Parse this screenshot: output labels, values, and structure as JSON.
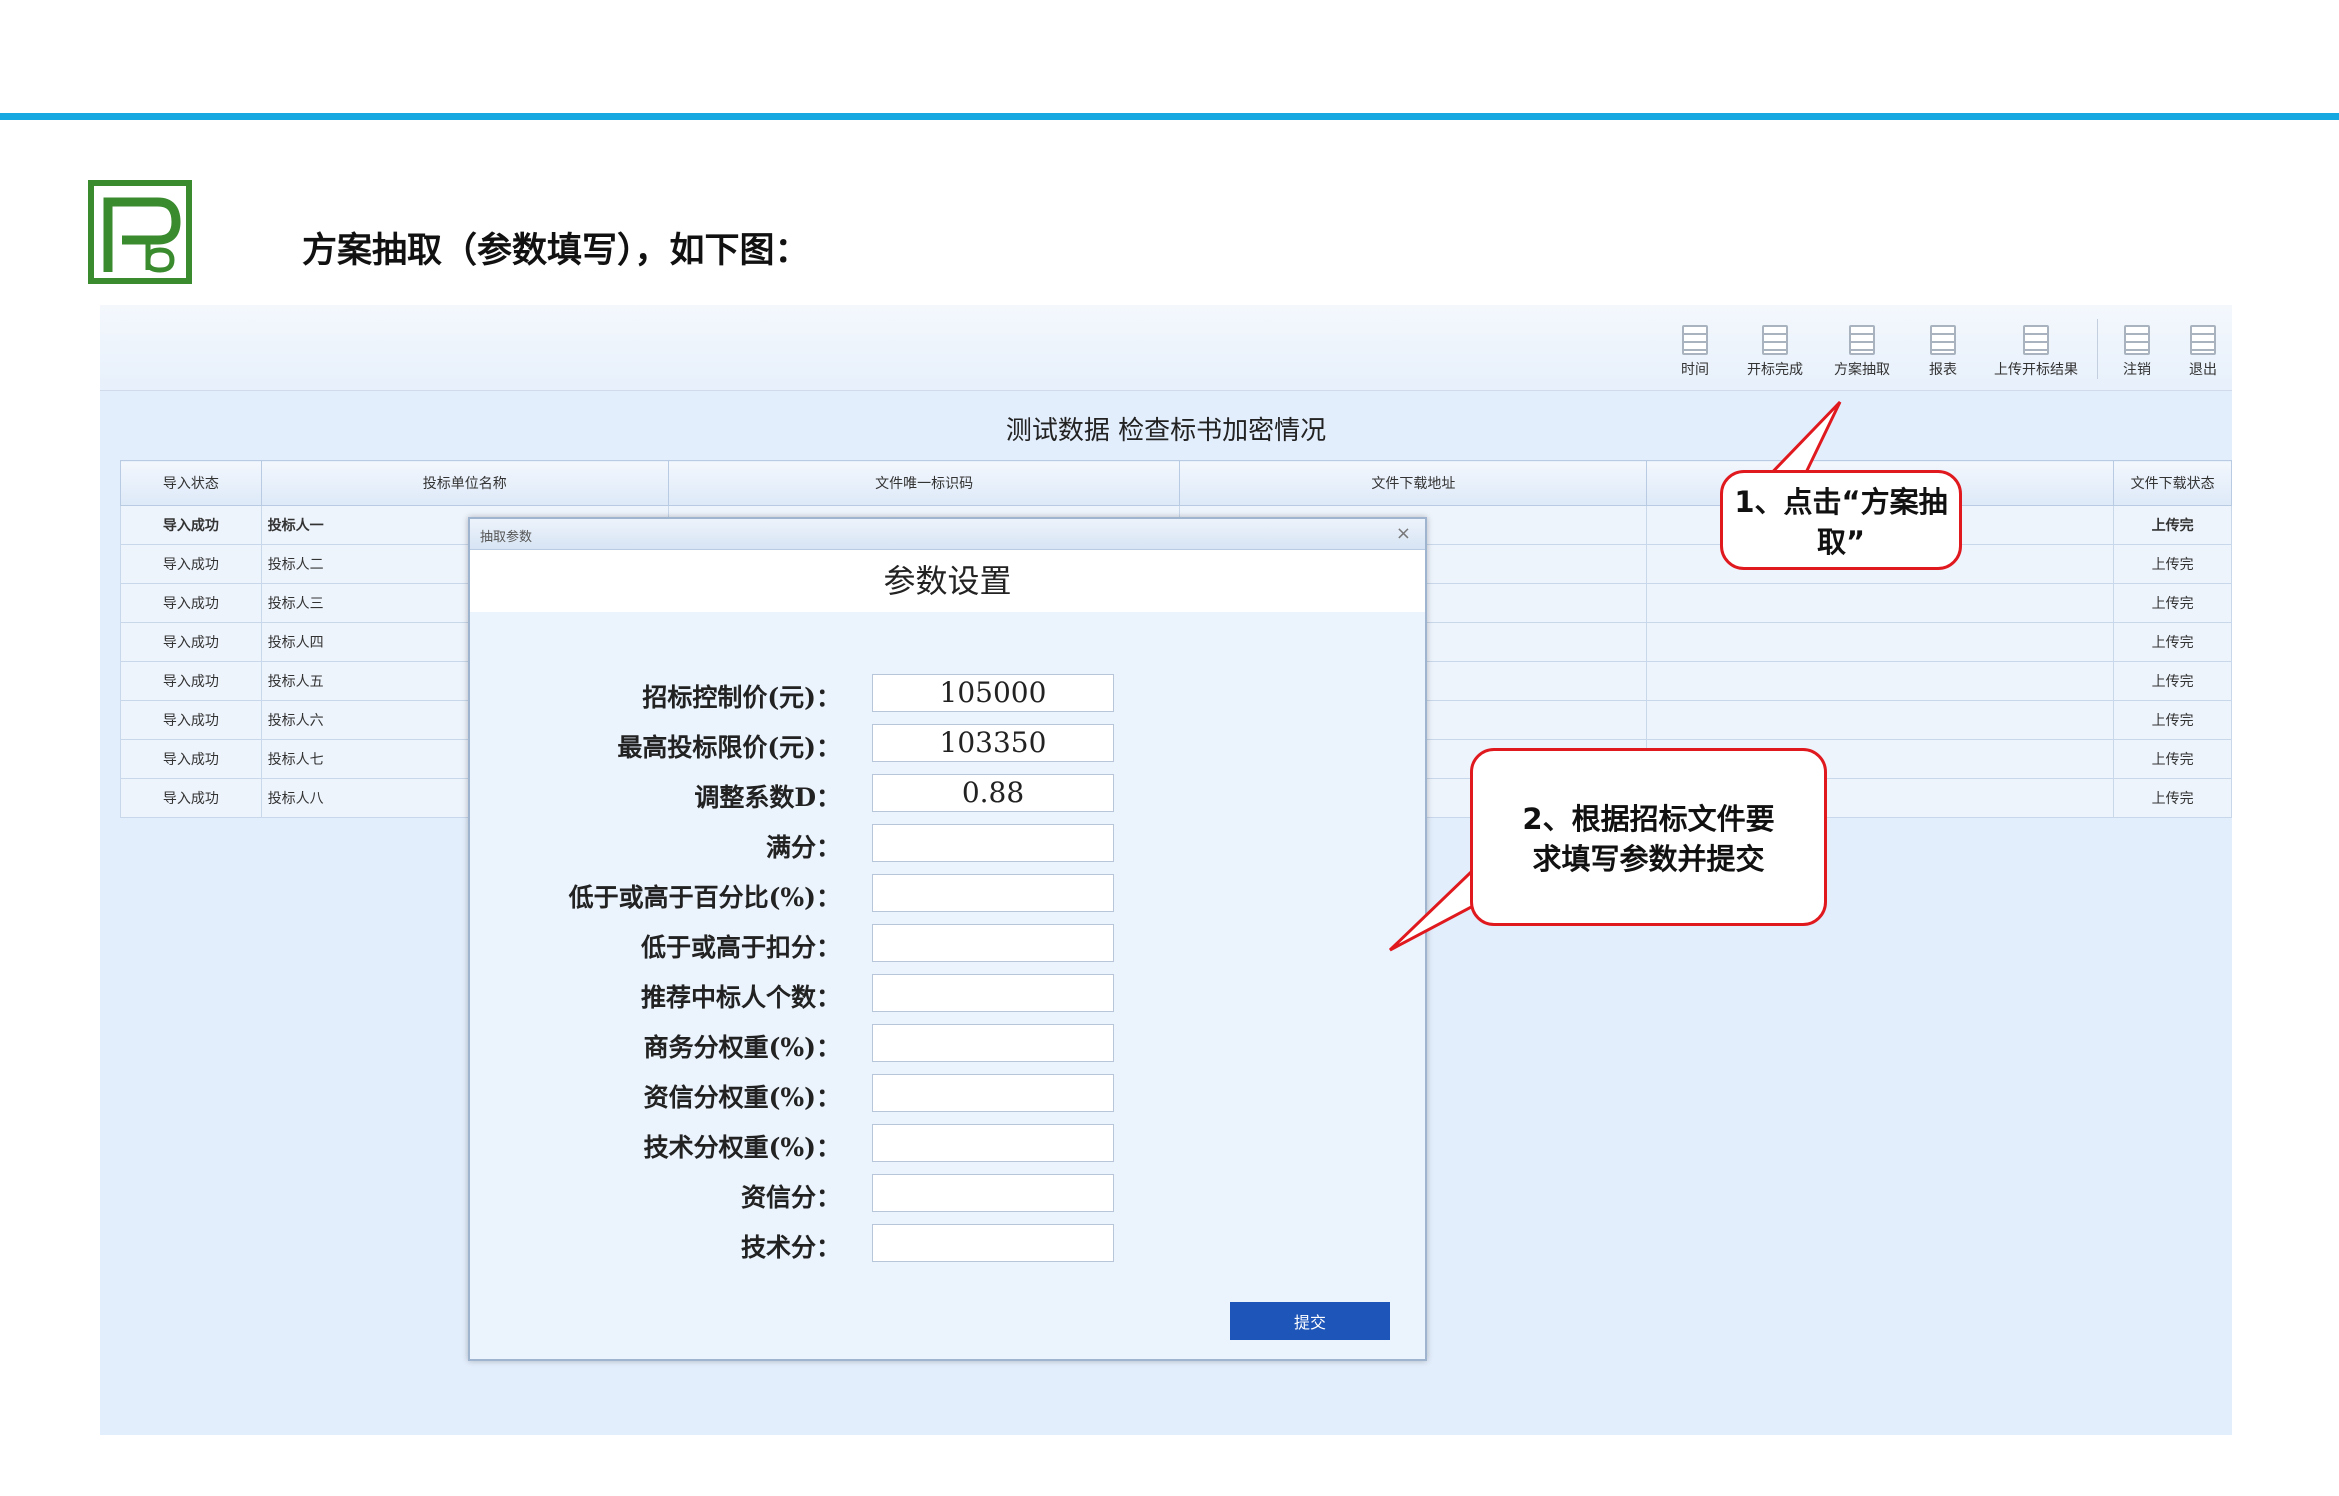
{
  "slide": {
    "heading": "方案抽取（参数填写），如下图："
  },
  "toolbar": {
    "buttons": [
      {
        "label": "时间",
        "icon": "document-icon"
      },
      {
        "label": "开标完成",
        "icon": "document-icon"
      },
      {
        "label": "方案抽取",
        "icon": "document-icon"
      },
      {
        "label": "报表",
        "icon": "document-icon"
      },
      {
        "label": "上传开标结果",
        "icon": "document-icon"
      },
      {
        "label": "注销",
        "icon": "document-icon"
      },
      {
        "label": "退出",
        "icon": "document-icon"
      }
    ]
  },
  "app": {
    "title": "测试数据 检查标书加密情况"
  },
  "table": {
    "headers": [
      "导入状态",
      "投标单位名称",
      "文件唯一标识码",
      "文件下载地址",
      "",
      "文件下载状态"
    ],
    "rows": [
      {
        "status": "导入成功",
        "name": "投标人一",
        "download_status": "上传完"
      },
      {
        "status": "导入成功",
        "name": "投标人二",
        "download_status": "上传完"
      },
      {
        "status": "导入成功",
        "name": "投标人三",
        "download_status": "上传完"
      },
      {
        "status": "导入成功",
        "name": "投标人四",
        "download_status": "上传完"
      },
      {
        "status": "导入成功",
        "name": "投标人五",
        "download_status": "上传完"
      },
      {
        "status": "导入成功",
        "name": "投标人六",
        "download_status": "上传完"
      },
      {
        "status": "导入成功",
        "name": "投标人七",
        "download_status": "上传完"
      },
      {
        "status": "导入成功",
        "name": "投标人八",
        "download_status": "上传完"
      }
    ]
  },
  "dialog": {
    "window_title": "抽取参数",
    "close_glyph": "×",
    "header": "参数设置",
    "fields": [
      {
        "label": "招标控制价(元)：",
        "value": "105000"
      },
      {
        "label": "最高投标限价(元)：",
        "value": "103350"
      },
      {
        "label": "调整系数D：",
        "value": "0.88"
      },
      {
        "label": "满分：",
        "value": ""
      },
      {
        "label": "低于或高于百分比(%)：",
        "value": ""
      },
      {
        "label": "低于或高于扣分：",
        "value": ""
      },
      {
        "label": "推荐中标人个数：",
        "value": ""
      },
      {
        "label": "商务分权重(%)：",
        "value": ""
      },
      {
        "label": "资信分权重(%)：",
        "value": ""
      },
      {
        "label": "技术分权重(%)：",
        "value": ""
      },
      {
        "label": "资信分：",
        "value": ""
      },
      {
        "label": "技术分：",
        "value": ""
      }
    ],
    "submit_label": "提交"
  },
  "callouts": {
    "step1": "1、点击“方案抽取”",
    "step2": "2、根据招标文件要求填写参数并提交"
  },
  "colors": {
    "accent_line": "#16a8e0",
    "callout_border": "#e0191f",
    "submit_button": "#1e55b8",
    "logo_green": "#3a8a2e"
  }
}
